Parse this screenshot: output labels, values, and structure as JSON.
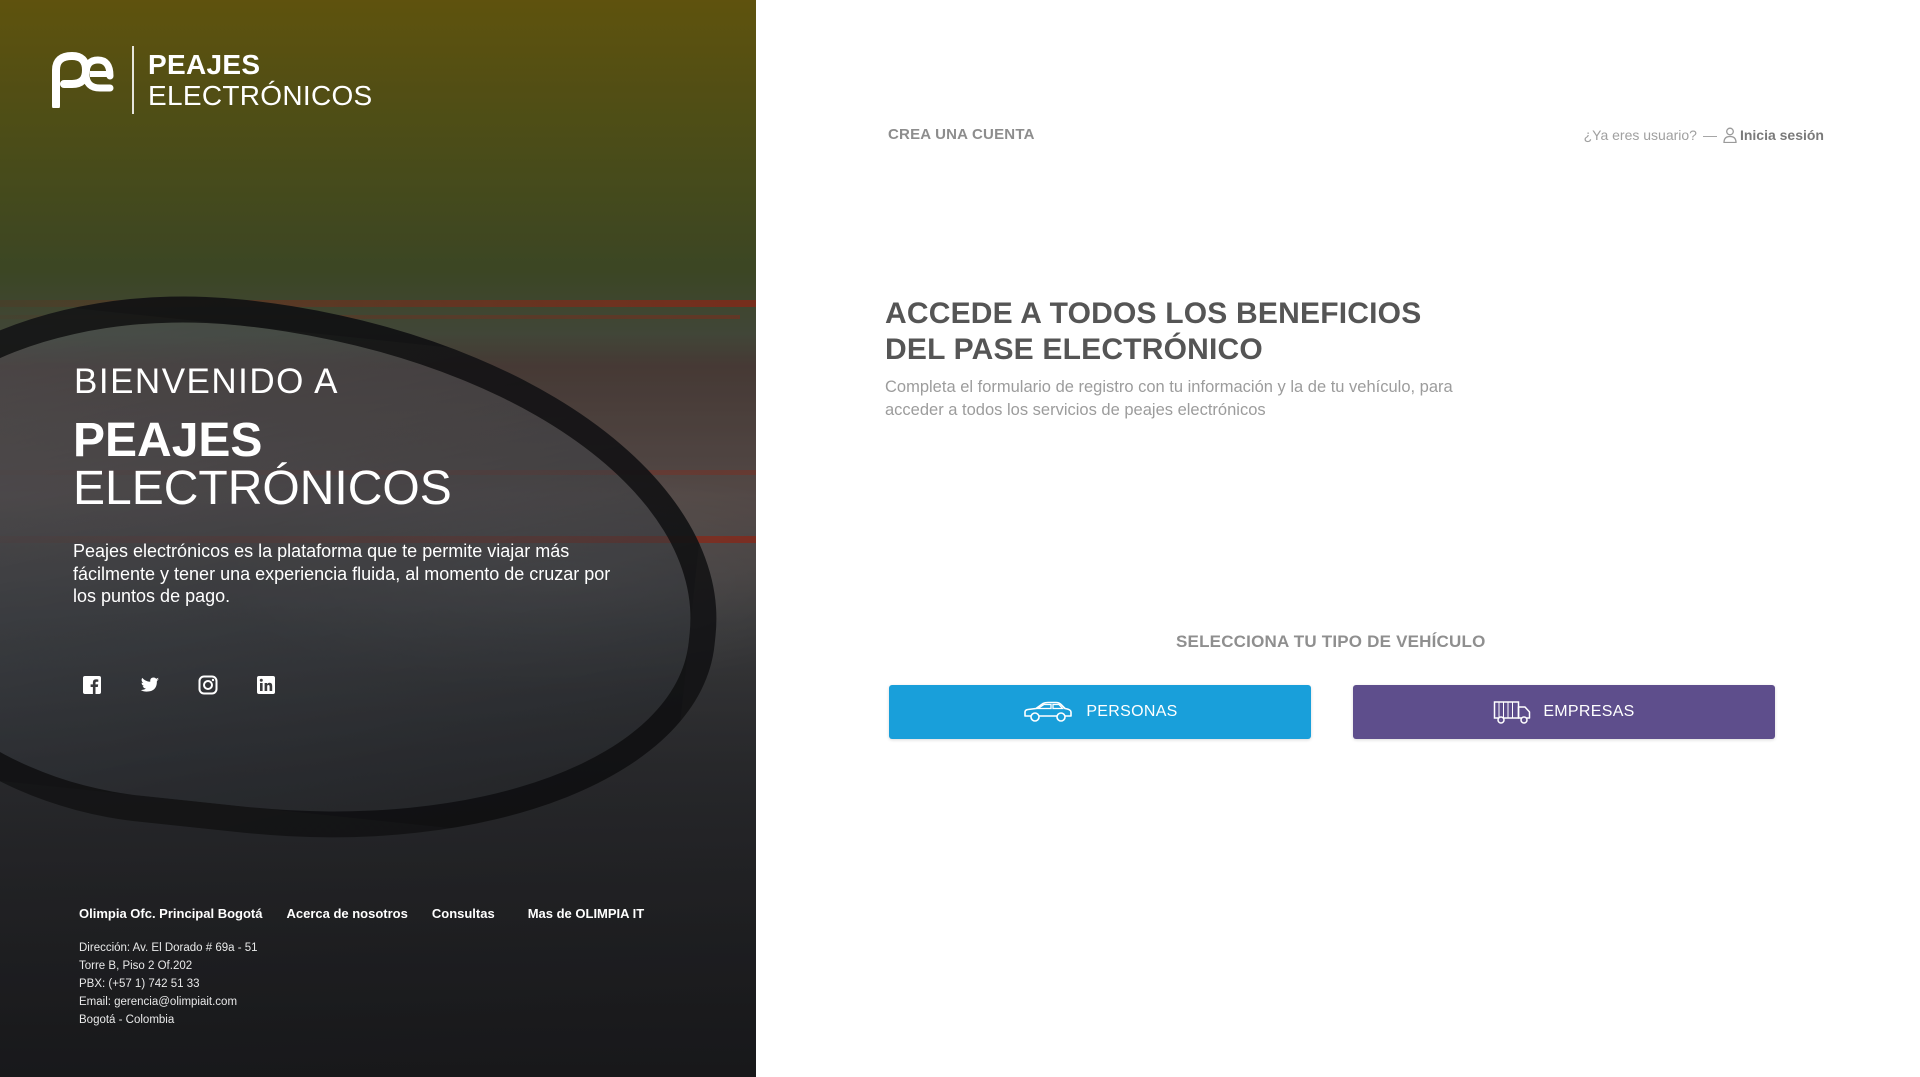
{
  "brand": {
    "line1": "PEAJES",
    "line2": "ELECTRÓNICOS"
  },
  "welcome": {
    "pre": "BIENVENIDO A",
    "title_line1": "PEAJES",
    "title_line2": "ELECTRÓNICOS",
    "description": "Peajes electrónicos es la plataforma que te permite viajar más fácilmente y tener una experiencia fluida, al momento de cruzar por los puntos de pago."
  },
  "socials": [
    {
      "icon": "facebook-icon"
    },
    {
      "icon": "twitter-icon"
    },
    {
      "icon": "instagram-icon"
    },
    {
      "icon": "linkedin-icon"
    }
  ],
  "footer": {
    "links": [
      "Olimpia Ofc. Principal Bogotá",
      "Acerca de nosotros",
      "Consultas",
      "Mas de OLIMPIA IT"
    ],
    "address": [
      "Dirección: Av. El Dorado # 69a - 51",
      "Torre B, Piso 2 Of.202",
      "PBX: (+57 1) 742 51 33",
      "Email: gerencia@olimpiait.com",
      "Bogotá - Colombia"
    ]
  },
  "header": {
    "crea_cuenta": "CREA UNA CUENTA",
    "ya_usuario": "¿Ya eres usuario?",
    "dash": "—",
    "inicia_sesion": "Inicia sesión"
  },
  "hero": {
    "title_line1": "ACCEDE A TODOS LOS BENEFICIOS",
    "title_line2": "DEL PASE ELECTRÓNICO",
    "description": "Completa el formulario de registro con tu información y la de tu vehículo, para acceder a todos los servicios de peajes electrónicos"
  },
  "vehicle": {
    "title": "SELECCIONA TU TIPO DE VEHÍCULO",
    "personas": "PERSONAS",
    "empresas": "EMPRESAS"
  },
  "colors": {
    "personas_button": "#199fda",
    "empresas_button": "#5e4e8c"
  }
}
